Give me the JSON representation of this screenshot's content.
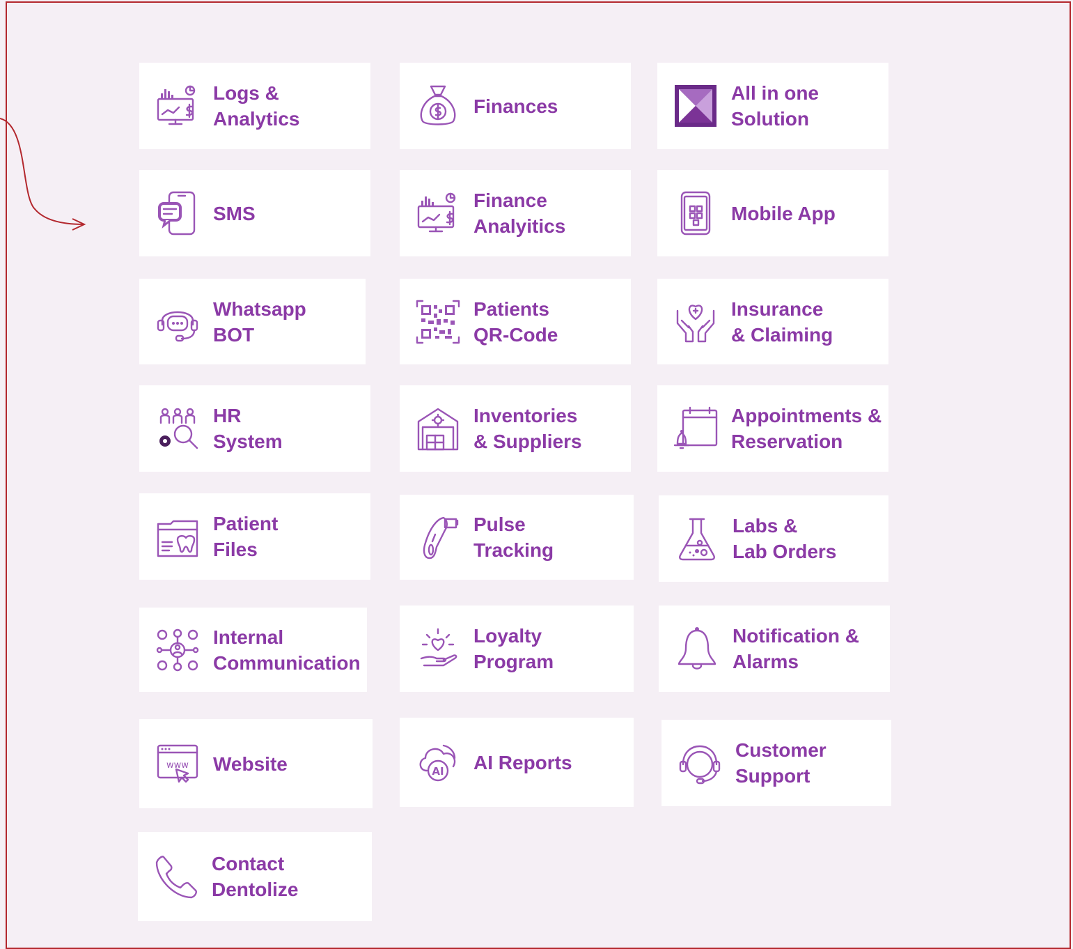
{
  "features": [
    {
      "id": "logs",
      "label": "Logs &\nAnalytics",
      "icon": "monitor-chart-icon"
    },
    {
      "id": "finances",
      "label": "Finances",
      "icon": "money-bag-icon"
    },
    {
      "id": "all-in-one",
      "label": "All in one\nSolution",
      "icon": "dentolize-logo-icon"
    },
    {
      "id": "sms",
      "label": "SMS",
      "icon": "phone-chat-icon"
    },
    {
      "id": "finance-analytics",
      "label": "Finance\nAnalyitics",
      "icon": "monitor-chart-icon"
    },
    {
      "id": "mobile-app",
      "label": "Mobile App",
      "icon": "smartphone-apps-icon"
    },
    {
      "id": "whatsapp",
      "label": "Whatsapp\nBOT",
      "icon": "headset-chat-icon"
    },
    {
      "id": "qr",
      "label": "Patients\nQR-Code",
      "icon": "qr-code-icon"
    },
    {
      "id": "insurance",
      "label": "Insurance\n& Claiming",
      "icon": "hands-heart-icon"
    },
    {
      "id": "hr",
      "label": "HR\nSystem",
      "icon": "people-search-icon"
    },
    {
      "id": "inventories",
      "label": "Inventories\n& Suppliers",
      "icon": "warehouse-icon"
    },
    {
      "id": "appointments",
      "label": "Appointments &\nReservation",
      "icon": "calendar-bell-icon"
    },
    {
      "id": "patient-files",
      "label": "Patient\nFiles",
      "icon": "folder-tooth-icon"
    },
    {
      "id": "pulse",
      "label": "Pulse\nTracking",
      "icon": "pulse-oximeter-icon"
    },
    {
      "id": "labs",
      "label": "Labs &\nLab Orders",
      "icon": "flask-icon"
    },
    {
      "id": "internal-comm",
      "label": "Internal\nCommunication",
      "icon": "team-network-icon"
    },
    {
      "id": "loyalty",
      "label": "Loyalty\nProgram",
      "icon": "hand-heart-icon"
    },
    {
      "id": "notifications",
      "label": "Notification &\nAlarms",
      "icon": "bell-icon"
    },
    {
      "id": "website",
      "label": "Website",
      "icon": "browser-www-icon"
    },
    {
      "id": "ai-reports",
      "label": "AI Reports",
      "icon": "ai-cloud-icon"
    },
    {
      "id": "support",
      "label": "Customer\nSupport",
      "icon": "headset-icon"
    },
    {
      "id": "contact",
      "label": "Contact\nDentolize",
      "icon": "phone-icon"
    }
  ],
  "colors": {
    "accent": "#8b3aa6",
    "icon": "#9a55b6",
    "border": "#b3282e",
    "background": "#f5eff5"
  }
}
